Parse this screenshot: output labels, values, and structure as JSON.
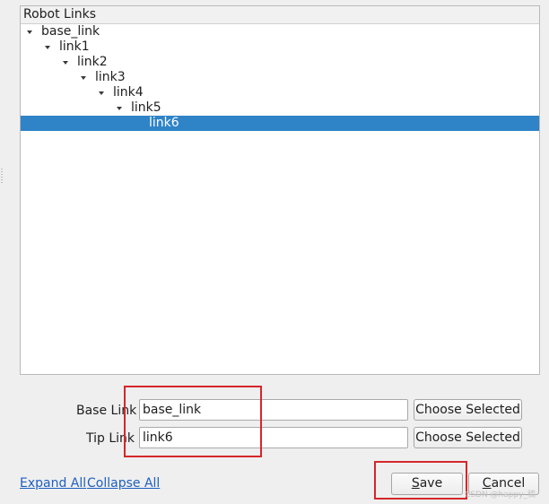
{
  "tree": {
    "header": "Robot Links",
    "items": [
      {
        "label": "base_link",
        "depth": 0,
        "expanded": true,
        "selected": false
      },
      {
        "label": "link1",
        "depth": 1,
        "expanded": true,
        "selected": false
      },
      {
        "label": "link2",
        "depth": 2,
        "expanded": true,
        "selected": false
      },
      {
        "label": "link3",
        "depth": 3,
        "expanded": true,
        "selected": false
      },
      {
        "label": "link4",
        "depth": 4,
        "expanded": true,
        "selected": false
      },
      {
        "label": "link5",
        "depth": 5,
        "expanded": true,
        "selected": false
      },
      {
        "label": "link6",
        "depth": 6,
        "expanded": false,
        "selected": true
      }
    ]
  },
  "form": {
    "base_link": {
      "label": "Base Link",
      "value": "base_link",
      "button": "Choose Selected"
    },
    "tip_link": {
      "label": "Tip Link",
      "value": "link6",
      "button": "Choose Selected"
    }
  },
  "footer": {
    "expand_all": "Expand All",
    "collapse_all": "Collapse All",
    "save_first": "S",
    "save_rest": "ave",
    "cancel_first": "C",
    "cancel_rest": "ancel"
  },
  "watermark": "CSDN @happy_稿",
  "colors": {
    "selection": "#2f83c7",
    "highlight_box": "#d6262b",
    "link": "#1f5fbf"
  }
}
